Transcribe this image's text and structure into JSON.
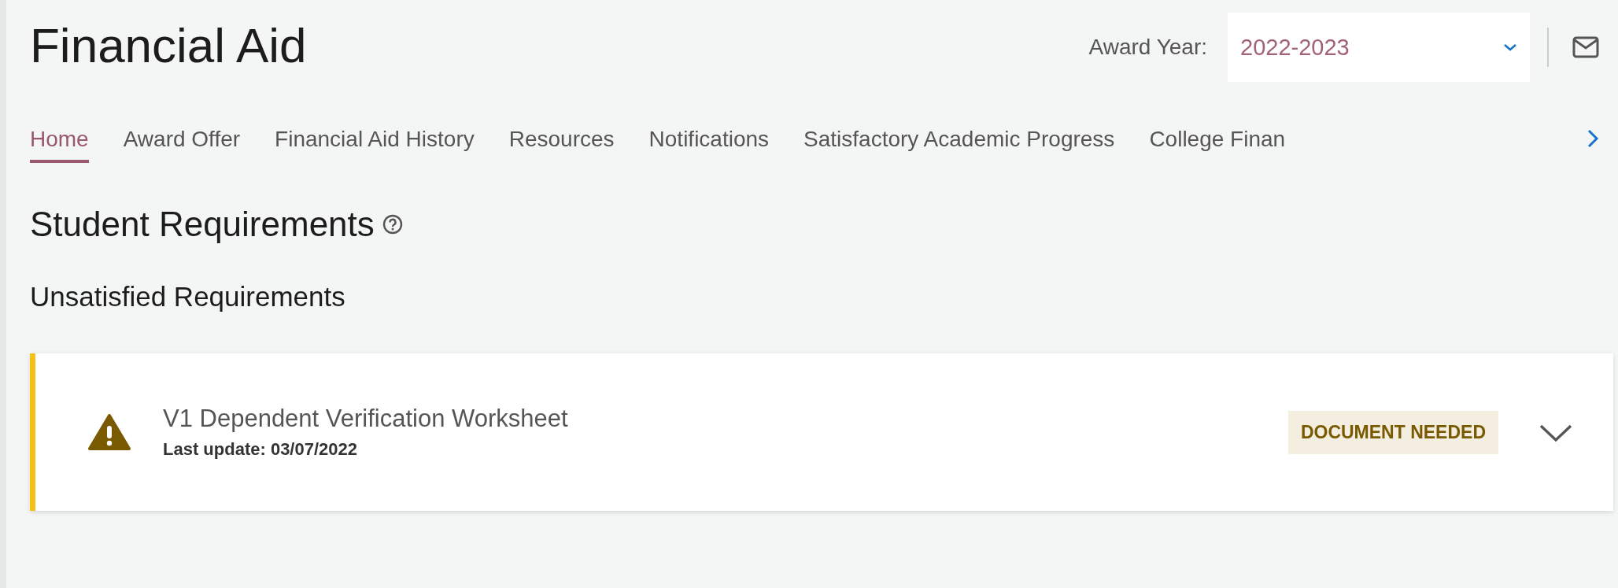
{
  "header": {
    "title": "Financial Aid",
    "award_year_label": "Award Year:",
    "award_year": {
      "value": "2022-2023"
    }
  },
  "tabs": [
    {
      "label": "Home",
      "selected": true
    },
    {
      "label": "Award Offer",
      "selected": false
    },
    {
      "label": "Financial Aid History",
      "selected": false
    },
    {
      "label": "Resources",
      "selected": false
    },
    {
      "label": "Notifications",
      "selected": false
    },
    {
      "label": "Satisfactory Academic Progress",
      "selected": false
    },
    {
      "label": "College Finan",
      "selected": false
    }
  ],
  "section_title": "Student Requirements",
  "subsection_title": "Unsatisfied Requirements",
  "requirements": [
    {
      "title": "V1 Dependent Verification Worksheet",
      "last_update": "Last update: 03/07/2022",
      "status": "DOCUMENT NEEDED",
      "expanded": false
    }
  ]
}
